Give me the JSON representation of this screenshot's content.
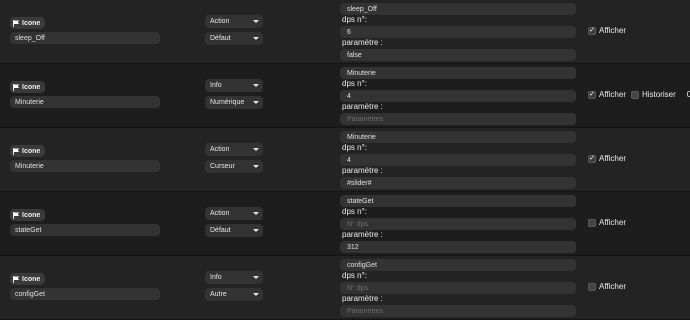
{
  "icon_label": "Icone",
  "labels": {
    "dps": "dps n°:",
    "param": "paramètre :",
    "show": "Afficher",
    "history": "Historiser"
  },
  "rows": [
    {
      "name": "sleep_Off",
      "type": "Action",
      "format": "Défaut",
      "field1": "sleep_Off",
      "dps": "6",
      "dps_ph": false,
      "param": "false",
      "param_ph": false,
      "show": true,
      "history": null,
      "count": null
    },
    {
      "name": "Minuterie",
      "type": "Info",
      "format": "Numérique",
      "field1": "Minuterie",
      "dps": "4",
      "dps_ph": false,
      "param": "Parametres",
      "param_ph": true,
      "show": true,
      "history": false,
      "count": "0"
    },
    {
      "name": "Minuterie",
      "type": "Action",
      "format": "Curseur",
      "field1": "Minuterie",
      "dps": "4",
      "dps_ph": false,
      "param": "#slider#",
      "param_ph": false,
      "show": true,
      "history": null,
      "count": null
    },
    {
      "name": "stateGet",
      "type": "Action",
      "format": "Défaut",
      "field1": "stateGet",
      "dps": "N° dps",
      "dps_ph": true,
      "param": "312",
      "param_ph": false,
      "show": false,
      "history": null,
      "count": null
    },
    {
      "name": "configGet",
      "type": "Info",
      "format": "Autre",
      "field1": "configGet",
      "dps": "N° dps",
      "dps_ph": true,
      "param": "Parametres",
      "param_ph": true,
      "show": false,
      "history": null,
      "count": null
    }
  ]
}
